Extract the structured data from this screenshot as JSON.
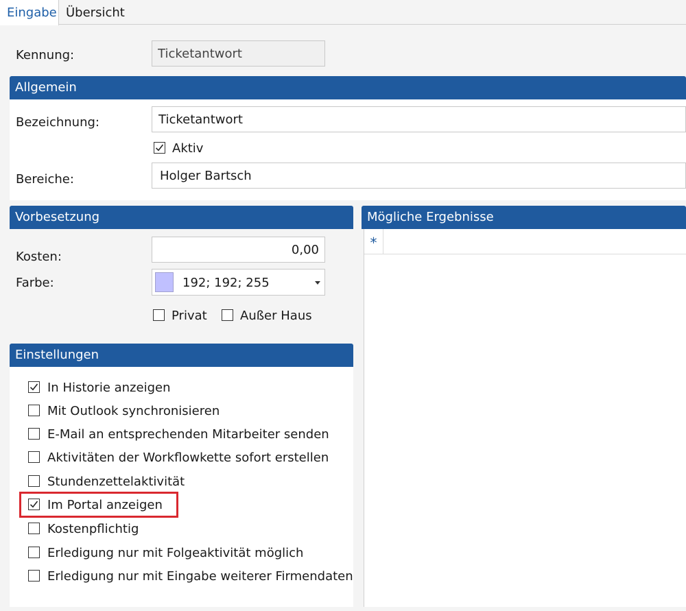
{
  "tabs": [
    {
      "label": "Eingabe"
    },
    {
      "label": "Übersicht"
    }
  ],
  "kennung": {
    "label": "Kennung:",
    "value": "Ticketantwort"
  },
  "allgemein": {
    "header": "Allgemein",
    "bezeichnung_label": "Bezeichnung:",
    "bezeichnung_value": "Ticketantwort",
    "aktiv_label": "Aktiv",
    "aktiv_checked": true,
    "bereiche_label": "Bereiche:",
    "bereiche_value": "Holger Bartsch"
  },
  "vorbesetzung": {
    "header": "Vorbesetzung",
    "kosten_label": "Kosten:",
    "kosten_value": "0,00",
    "farbe_label": "Farbe:",
    "farbe_value": "192; 192; 255",
    "farbe_swatch": "#c0c0ff",
    "privat_label": "Privat",
    "privat_checked": false,
    "ausser_haus_label": "Außer Haus",
    "ausser_haus_checked": false
  },
  "ergebnisse": {
    "header": "Mögliche Ergebnisse",
    "new_row_marker": "*"
  },
  "einstellungen": {
    "header": "Einstellungen",
    "items": [
      {
        "label": "In Historie anzeigen",
        "checked": true
      },
      {
        "label": "Mit Outlook synchronisieren",
        "checked": false
      },
      {
        "label": "E-Mail an entsprechenden Mitarbeiter senden",
        "checked": false
      },
      {
        "label": "Aktivitäten der Workflowkette sofort erstellen",
        "checked": false
      },
      {
        "label": "Stundenzettelaktivität",
        "checked": false
      },
      {
        "label": "Im Portal anzeigen",
        "checked": true
      },
      {
        "label": "Kostenpflichtig",
        "checked": false
      },
      {
        "label": "Erledigung nur mit Folgeaktivität möglich",
        "checked": false
      },
      {
        "label": "Erledigung nur mit Eingabe weiterer Firmendaten",
        "checked": false
      }
    ]
  },
  "colors": {
    "header_blue": "#1f5a9e",
    "tab_active_text": "#1e5fa8",
    "highlight_red": "#d9282f"
  }
}
